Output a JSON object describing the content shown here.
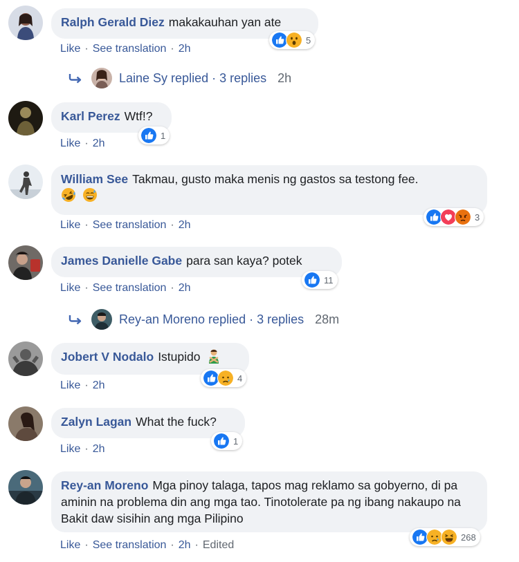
{
  "comments": [
    {
      "name": "Ralph Gerald Diez",
      "text": "makakauhan yan ate",
      "actions": [
        "Like",
        "See translation",
        "2h"
      ],
      "reaction_count": "5",
      "reactions": [
        "like-icon",
        "wow-icon"
      ]
    },
    {
      "name": "Karl Perez",
      "text": "Wtf!?",
      "actions": [
        "Like",
        "2h"
      ],
      "reaction_count": "1",
      "reactions": [
        "like-icon"
      ]
    },
    {
      "name": "William See",
      "text": "Takmau, gusto maka menis ng gastos sa testong fee.",
      "actions": [
        "Like",
        "See translation",
        "2h"
      ],
      "reaction_count": "3",
      "reactions": [
        "like-icon",
        "love-icon",
        "angry-icon"
      ],
      "emojis": [
        "rofl-emoji",
        "grin-sweat-emoji"
      ]
    },
    {
      "name": "James Danielle Gabe",
      "text": "para san kaya? potek",
      "actions": [
        "Like",
        "See translation",
        "2h"
      ],
      "reaction_count": "11",
      "reactions": [
        "like-icon"
      ]
    },
    {
      "name": "Jobert V Nodalo",
      "text": "Istupido",
      "actions": [
        "Like",
        "2h"
      ],
      "reaction_count": "4",
      "reactions": [
        "like-icon",
        "sad-icon"
      ],
      "emojis": [
        "man-gesturing-no-emoji"
      ]
    },
    {
      "name": "Zalyn Lagan",
      "text": "What the fuck?",
      "actions": [
        "Like",
        "2h"
      ],
      "reaction_count": "1",
      "reactions": [
        "like-icon"
      ]
    },
    {
      "name": "Rey-an Moreno",
      "text": "Mga pinoy talaga, tapos mag reklamo sa gobyerno, di pa aminin na problema din ang mga tao. Tinotolerate pa ng ibang nakaupo na Bakit daw sisihin ang mga Pilipino",
      "actions": [
        "Like",
        "See translation",
        "2h",
        "Edited"
      ],
      "reaction_count": "268",
      "reactions": [
        "like-icon",
        "sad-icon",
        "haha-icon"
      ]
    }
  ],
  "replies": [
    {
      "text": "Laine Sy replied · 3 replies",
      "time": "2h"
    },
    {
      "text": "Rey-an Moreno replied · 3 replies",
      "time": "28m"
    }
  ],
  "colors": {
    "name": "#385898",
    "bubble": "#f0f2f5",
    "like": "#1877f2",
    "love": "#f33e58",
    "wow": "#f7b125",
    "angry": "#e9710f"
  }
}
